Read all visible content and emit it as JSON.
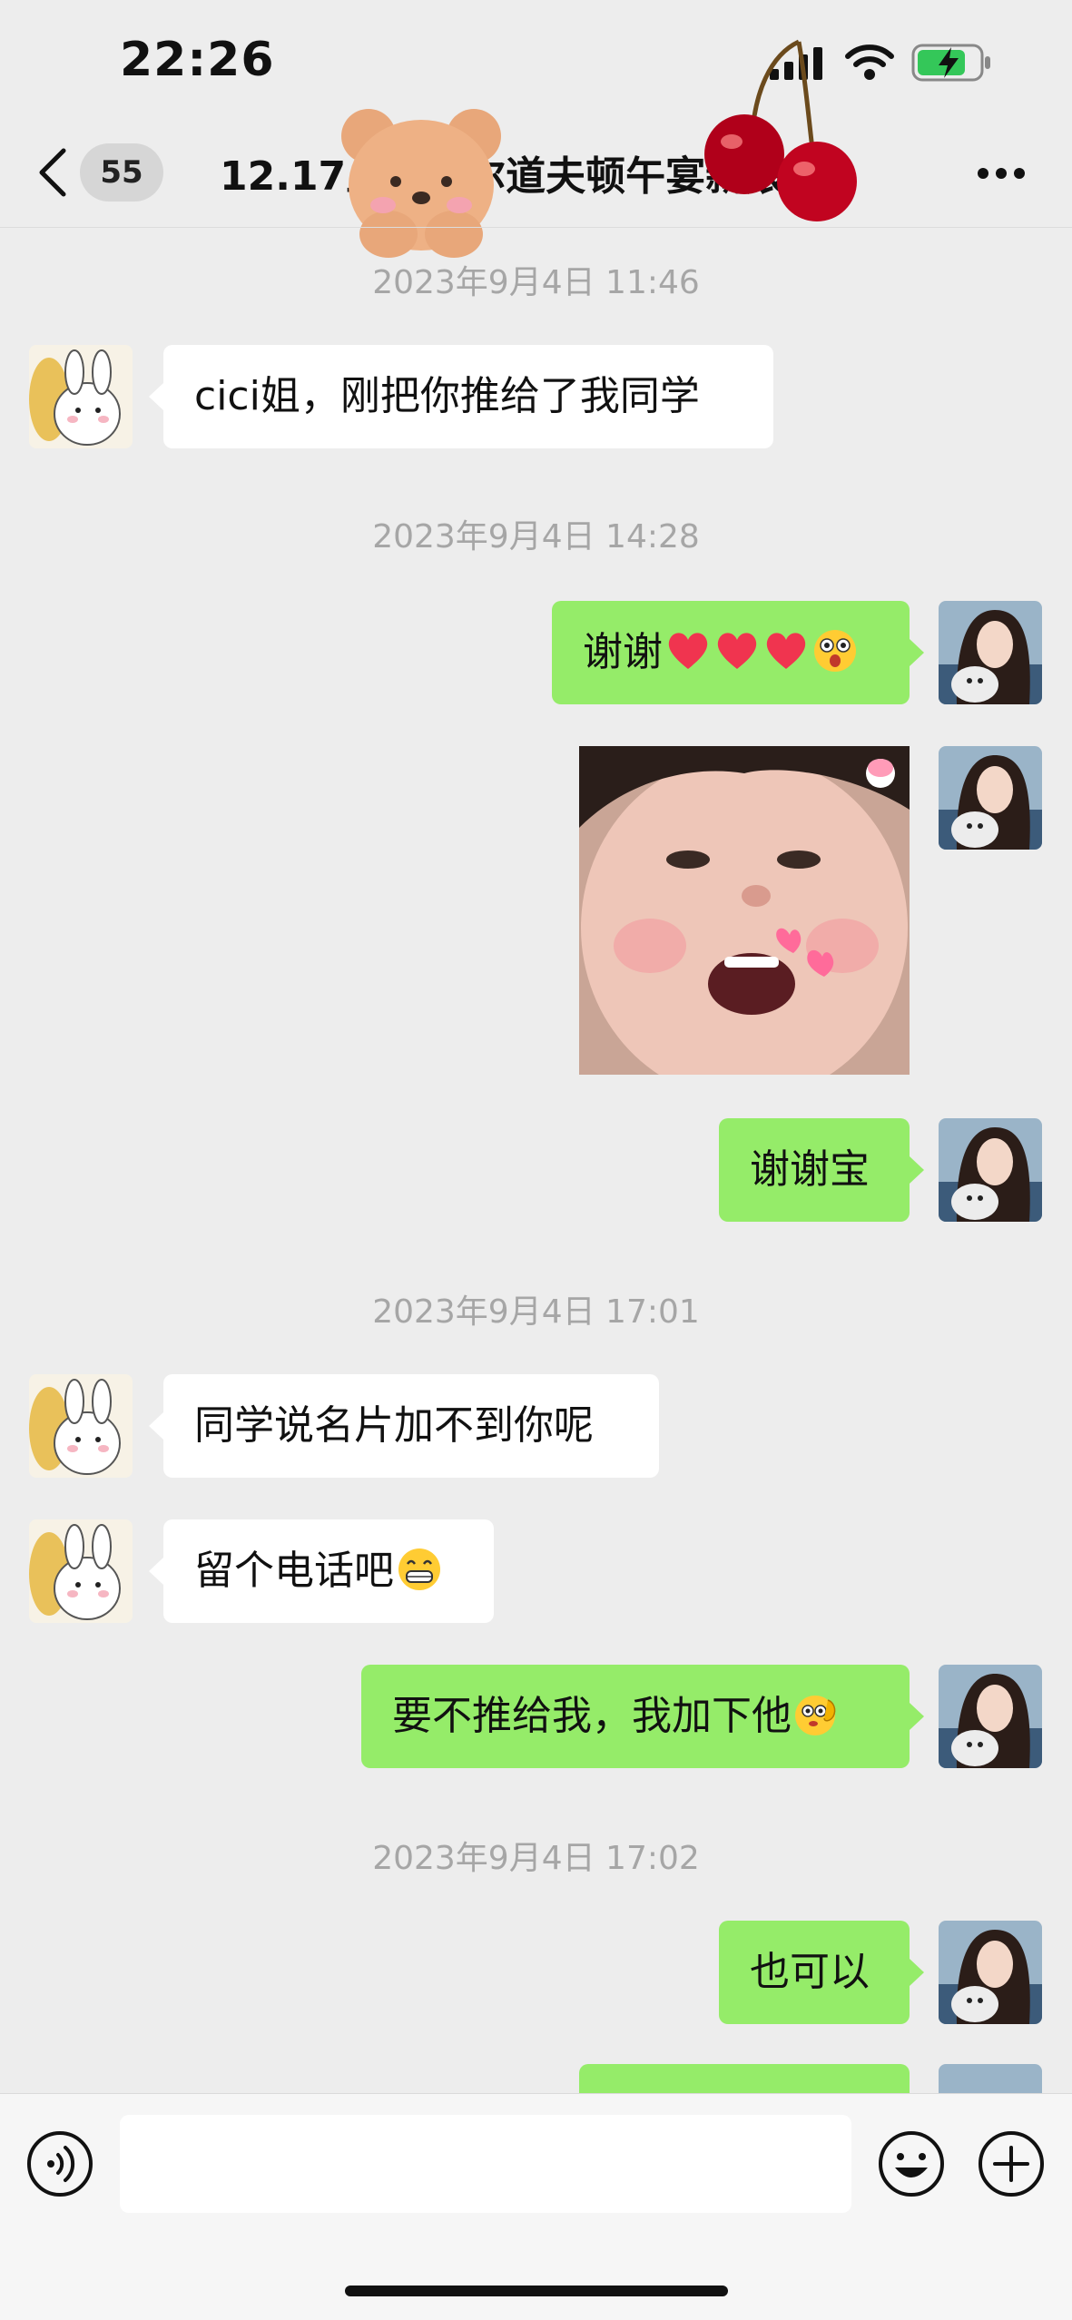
{
  "status_bar": {
    "time": "22:26",
    "icons": [
      "signal-icon",
      "wifi-icon",
      "battery-charging-icon"
    ],
    "battery_color": "#34c759"
  },
  "nav": {
    "back_icon": "chevron-left-icon",
    "unread_count": "55",
    "title": "12.17上海华尔道夫顿午宴新娘群",
    "more_icon": "more-dots-icon"
  },
  "colors": {
    "incoming_bubble": "#ffffff",
    "outgoing_bubble": "#95ec69",
    "background": "#ededed",
    "timestamp": "#a6a6a6"
  },
  "messages": [
    {
      "type": "timestamp",
      "text": "2023年9月4日 11:46"
    },
    {
      "type": "text",
      "direction": "in",
      "text": "cici姐，刚把你推给了我同学"
    },
    {
      "type": "timestamp",
      "text": "2023年9月4日 14:28"
    },
    {
      "type": "text",
      "direction": "out",
      "text": "谢谢",
      "emoji": [
        "heart-emoji",
        "heart-emoji",
        "heart-emoji",
        "surprised-face-emoji"
      ]
    },
    {
      "type": "sticker",
      "direction": "out",
      "description": "baby-face-sticker"
    },
    {
      "type": "text",
      "direction": "out",
      "text": "谢谢宝"
    },
    {
      "type": "timestamp",
      "text": "2023年9月4日 17:01"
    },
    {
      "type": "text",
      "direction": "in",
      "text": "同学说名片加不到你呢"
    },
    {
      "type": "text",
      "direction": "in",
      "text": "留个电话吧",
      "emoji": [
        "grinning-face-emoji"
      ]
    },
    {
      "type": "text",
      "direction": "out",
      "text": "要不推给我，我加下他",
      "emoji": [
        "ok-hand-face-emoji"
      ]
    },
    {
      "type": "timestamp",
      "text": "2023年9月4日 17:02"
    },
    {
      "type": "text",
      "direction": "out",
      "text": "也可以"
    }
  ],
  "input_bar": {
    "voice_icon": "voice-icon",
    "emoji_icon": "emoji-face-icon",
    "plus_icon": "plus-icon",
    "value": ""
  }
}
